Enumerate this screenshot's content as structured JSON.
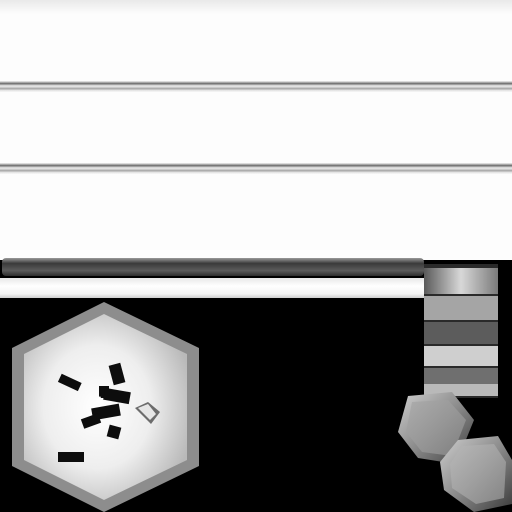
{
  "texture": {
    "icons": {
      "hex_panel": "hexagon-icon",
      "fragments": "fragment-icon",
      "crystal": "crystal-icon",
      "column": "column-icon"
    },
    "colors": {
      "background": "#000000",
      "panel": "#fdfdfd",
      "rule": "#6a6a6a",
      "hex_fill": "#f2f2f2",
      "hex_rim": "#8a8a8a",
      "fragment": "#0c0c0c",
      "crystal": "#9a9a9a"
    }
  }
}
